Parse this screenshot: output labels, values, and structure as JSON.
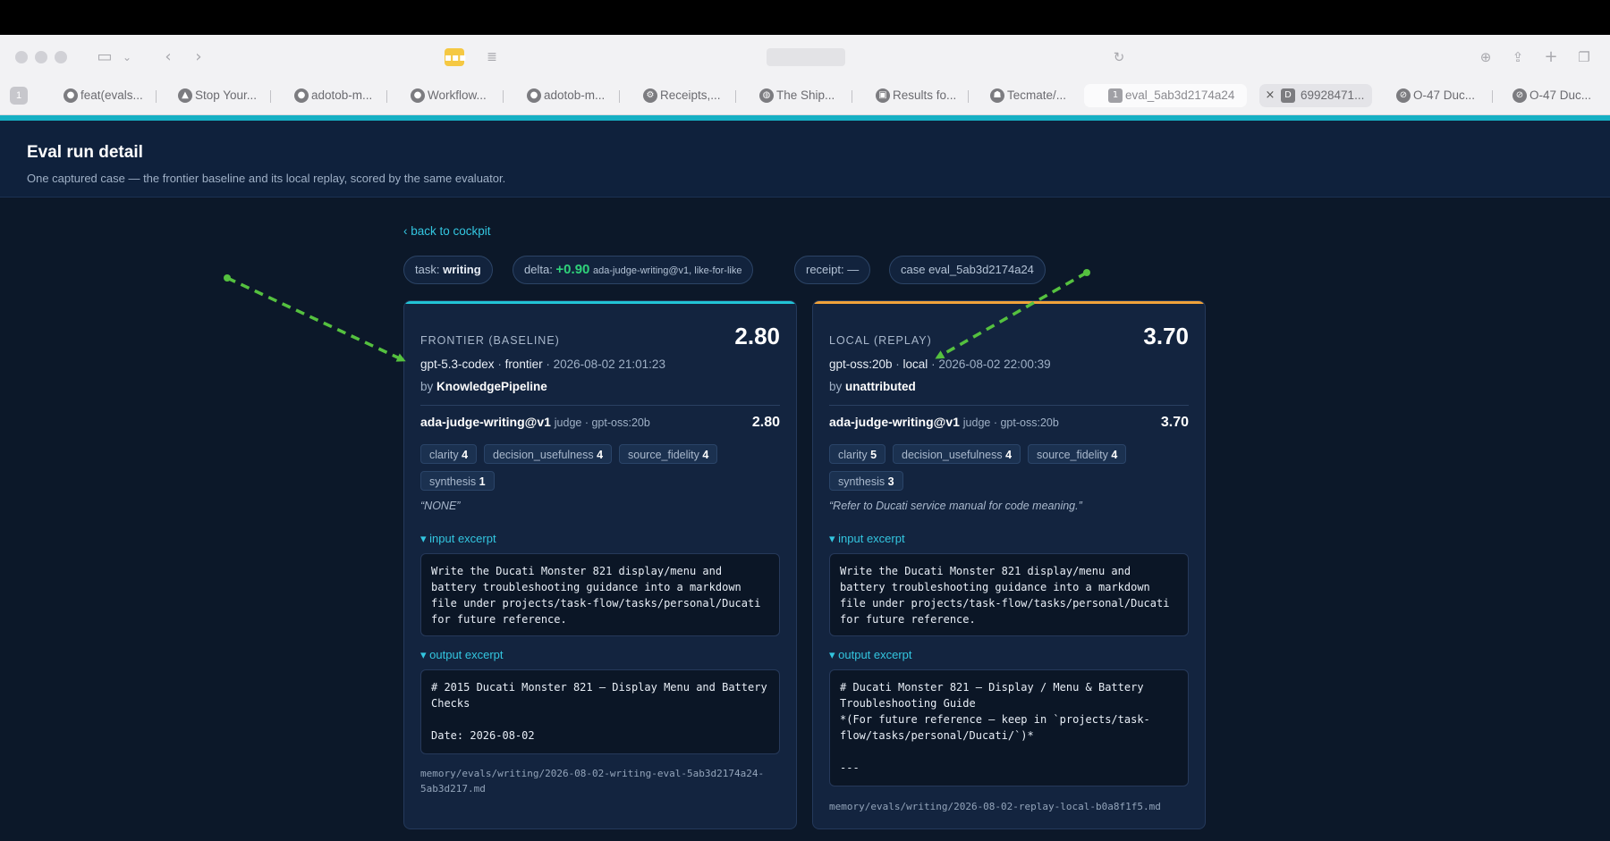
{
  "browser": {
    "tab_count": "1",
    "tabs": [
      {
        "label": "feat(evals..."
      },
      {
        "label": "Stop Your..."
      },
      {
        "label": "adotob-m..."
      },
      {
        "label": "Workflow..."
      },
      {
        "label": "adotob-m..."
      },
      {
        "label": "Receipts,..."
      },
      {
        "label": "The Ship..."
      },
      {
        "label": "Results fo..."
      },
      {
        "label": "Tecmate/..."
      },
      {
        "label": "eval_5ab3d2174a24"
      },
      {
        "label": "69928471..."
      },
      {
        "label": "O-47 Duc..."
      },
      {
        "label": "O-47 Duc..."
      }
    ]
  },
  "header": {
    "title": "Eval run detail",
    "subtitle": "One captured case — the frontier baseline and its local replay, scored by the same evaluator."
  },
  "nav": {
    "back_label": "‹ back to cockpit"
  },
  "chips": {
    "task_prefix": "task: ",
    "task_value": "writing",
    "delta_prefix": "delta: ",
    "delta_value": "+0.90",
    "delta_note": "ada-judge-writing@v1, like-for-like",
    "receipt": "receipt: —",
    "case": "case eval_5ab3d2174a24"
  },
  "frontier": {
    "label": "FRONTIER (BASELINE)",
    "score": "2.80",
    "model": "gpt-5.3-codex",
    "sep1": " · ",
    "kind": "frontier",
    "sep2": " · ",
    "timestamp": "2026-08-02 21:01:23",
    "by_prefix": "by ",
    "by": "KnowledgePipeline",
    "judge_name": "ada-judge-writing@v1",
    "judge_meta": "judge · gpt-oss:20b",
    "judge_score": "2.80",
    "criteria": [
      {
        "name": "clarity",
        "score": "4"
      },
      {
        "name": "decision_usefulness",
        "score": "4"
      },
      {
        "name": "source_fidelity",
        "score": "4"
      },
      {
        "name": "synthesis",
        "score": "1"
      }
    ],
    "quote": "“NONE”",
    "input_label": "▾ input excerpt",
    "input_text": "Write the Ducati Monster 821 display/menu and\nbattery troubleshooting guidance into a markdown\nfile under projects/task-flow/tasks/personal/Ducati\nfor future reference.",
    "output_label": "▾ output excerpt",
    "output_text": "# 2015 Ducati Monster 821 — Display Menu and Battery\nChecks\n\nDate: 2026-08-02",
    "path": "memory/evals/writing/2026-08-02-writing-eval-5ab3d2174a24-5ab3d217.md"
  },
  "local": {
    "label": "LOCAL (REPLAY)",
    "score": "3.70",
    "model": "gpt-oss:20b",
    "sep1": " · ",
    "kind": "local",
    "sep2": " · ",
    "timestamp": "2026-08-02 22:00:39",
    "by_prefix": "by ",
    "by": "unattributed",
    "judge_name": "ada-judge-writing@v1",
    "judge_meta": "judge · gpt-oss:20b",
    "judge_score": "3.70",
    "criteria": [
      {
        "name": "clarity",
        "score": "5"
      },
      {
        "name": "decision_usefulness",
        "score": "4"
      },
      {
        "name": "source_fidelity",
        "score": "4"
      },
      {
        "name": "synthesis",
        "score": "3"
      }
    ],
    "quote": "“Refer to Ducati service manual for code meaning.”",
    "input_label": "▾ input excerpt",
    "input_text": "Write the Ducati Monster 821 display/menu and\nbattery troubleshooting guidance into a markdown\nfile under projects/task-flow/tasks/personal/Ducati\nfor future reference.",
    "output_label": "▾ output excerpt",
    "output_text": "# Ducati Monster 821 — Display / Menu & Battery\nTroubleshooting Guide\n*(For future reference — keep in `projects/task-\nflow/tasks/personal/Ducati/`)*\n\n---",
    "path": "memory/evals/writing/2026-08-02-replay-local-b0a8f1f5.md"
  },
  "colors": {
    "accent": "#16b0c4",
    "frontier_top": "#22c3d6",
    "local_top": "#f0a23a",
    "delta_positive": "#2fd17a",
    "annotation_arrow": "#55c13f"
  }
}
